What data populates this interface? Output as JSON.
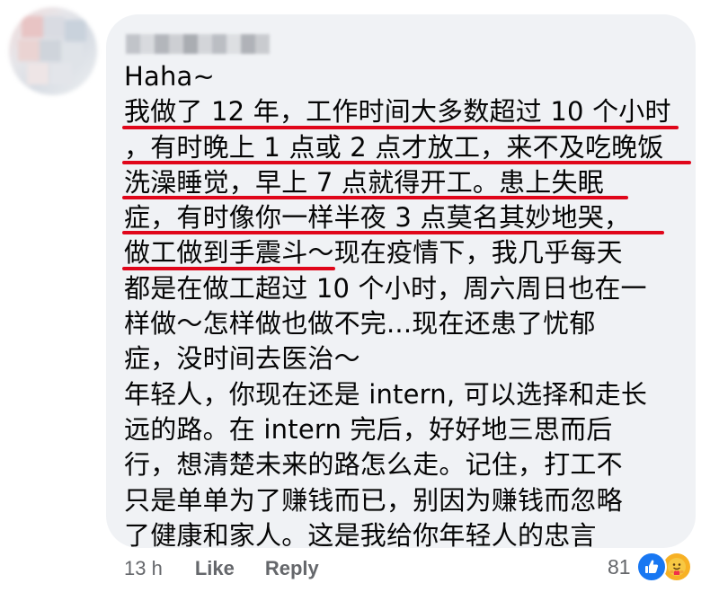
{
  "comment": {
    "lines": [
      {
        "text": "Haha~"
      },
      {
        "text": "我做了 12 年，工作时间大多数超过 10 个小时"
      },
      {
        "text": "，有时晚上 1 点或 2 点才放工，来不及吃晚饭"
      },
      {
        "text": "洗澡睡觉，早上 7 点就得开工。患上失眠"
      },
      {
        "text": "症，有时像你一样半夜 3 点莫名其妙地哭，"
      },
      {
        "text": "做工做到手震斗～现在疫情下，我几乎每天"
      },
      {
        "text": "都是在做工超过 10 个小时，周六周日也在一"
      },
      {
        "text": "样做～怎样做也做不完...现在还患了忧郁"
      },
      {
        "text": "症，没时间去医治～"
      },
      {
        "text": "年轻人，你现在还是 intern, 可以选择和走长"
      },
      {
        "text": "远的路。在 intern 完后，好好地三思而后"
      },
      {
        "text": "行，想清楚未来的路怎么走。记住，打工不"
      },
      {
        "text": "只是单单为了赚钱而已，别因为赚钱而忽略"
      },
      {
        "text": "了健康和家人。这是我给你年轻人的忠言"
      }
    ],
    "underline_color": "#e0061a"
  },
  "footer": {
    "time": "13 h",
    "like_label": "Like",
    "reply_label": "Reply"
  },
  "reactions": {
    "count": "81",
    "icons": [
      "like-icon",
      "care-icon"
    ]
  },
  "colors": {
    "bubble": "#f0f2f5",
    "meta_text": "#65676b",
    "body_text": "#050505",
    "like_blue": "#1877f2",
    "care_yellow": "#f7b125"
  }
}
